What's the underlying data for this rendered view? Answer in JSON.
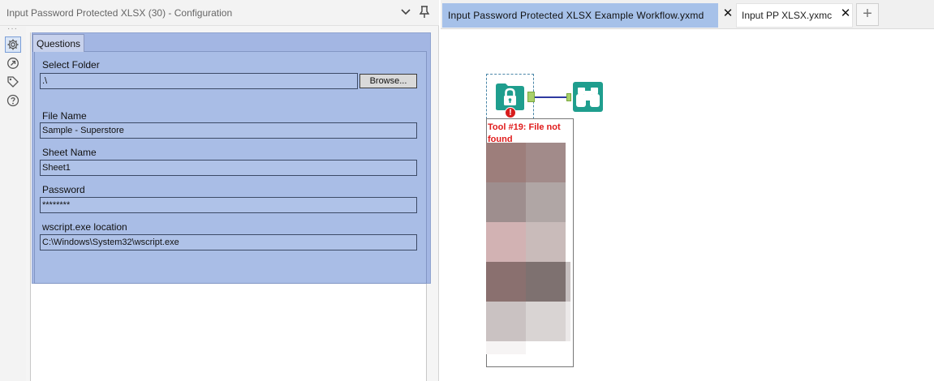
{
  "config": {
    "title": "Input Password Protected XLSX (30) - Configuration",
    "rail_dots": "···",
    "rail_icons": [
      "gear-icon",
      "arrow-circle-icon",
      "tag-icon",
      "help-icon"
    ],
    "tab_label": "Questions",
    "fields": {
      "folder": {
        "label": "Select Folder",
        "value": ".\\"
      },
      "browse_label": "Browse...",
      "file_name": {
        "label": "File Name",
        "value": "Sample - Superstore"
      },
      "sheet_name": {
        "label": "Sheet Name",
        "value": "Sheet1"
      },
      "password": {
        "label": "Password",
        "value": "********"
      },
      "wscript": {
        "label": "wscript.exe location",
        "value": "C:\\Windows\\System32\\wscript.exe"
      }
    }
  },
  "canvas": {
    "tabs": [
      {
        "label": "Input  Password  Protected  XLSX  Example  Workflow.yxmd",
        "active": true
      },
      {
        "label": "Input PP XLSX.yxmc",
        "active": false
      }
    ],
    "close_glyph": "✕",
    "add_tab_glyph": "+",
    "error_badge": "!",
    "error_message": "Tool #19: File not found"
  },
  "colors": {
    "accent": "#a6c1e9",
    "questions_bg": "#a9bde6",
    "tool_teal": "#1f9e8e",
    "error_red": "#e01b1b",
    "connector": "#2f3aa0"
  }
}
